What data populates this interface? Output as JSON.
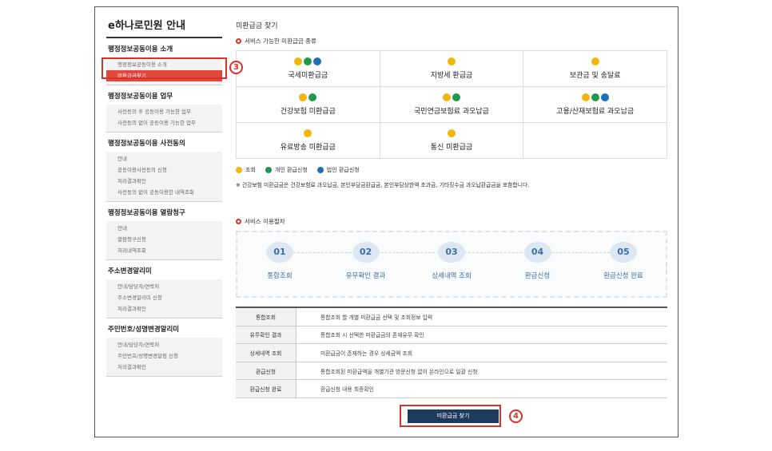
{
  "sidebar": {
    "title": "e하나로민원 안내",
    "groups": [
      {
        "title": "행정정보공동이용 소개",
        "items": [
          "행정정보공동이용 소개",
          "미환급금찾기"
        ]
      },
      {
        "title": "행정정보공동이용 업무",
        "items": [
          "사전동의 후 공동이용 가능한 업무",
          "사전동의 없이 공동이용 가능한 업무"
        ]
      },
      {
        "title": "행정정보공동이용 사전동의",
        "items": [
          "안내",
          "공동이용사전동의 신청",
          "처리결과확인",
          "사전동의 없이 공동이용한 내역조회"
        ]
      },
      {
        "title": "행정정보공동이용 열람청구",
        "items": [
          "안내",
          "열람청구신청",
          "처리내역조회"
        ]
      },
      {
        "title": "주소변경알리미",
        "items": [
          "안내/담당자/연락처",
          "주소변경알리미 신청",
          "처리결과확인"
        ]
      },
      {
        "title": "주민번호/성명변경알리미",
        "items": [
          "안내/담당자/연락처",
          "주민번호/성명변경알림 신청",
          "처리결과확인"
        ]
      }
    ]
  },
  "annotations": {
    "badge3": "3",
    "badge4": "4"
  },
  "main": {
    "page_title": "미환급금 찾기",
    "section1_title": "서비스 가능한 미환급금 종류",
    "cells": [
      {
        "label": "국세미환급금",
        "dots": [
          "#f2b70f",
          "#1f9a4a",
          "#1f6fb5"
        ]
      },
      {
        "label": "지방세 환급금",
        "dots": [
          "#f2b70f"
        ]
      },
      {
        "label": "보관금 및 송달료",
        "dots": [
          "#f2b70f"
        ]
      },
      {
        "label": "건강보험 미환급금",
        "dots": [
          "#f2b70f",
          "#1f9a4a"
        ]
      },
      {
        "label": "국민연금보험료 과오납금",
        "dots": [
          "#f2b70f",
          "#1f9a4a"
        ]
      },
      {
        "label": "고용/산재보험료 과오납금",
        "dots": [
          "#f2b70f",
          "#1f9a4a",
          "#1f6fb5"
        ]
      },
      {
        "label": "유료방송 미환급금",
        "dots": [
          "#f2b70f"
        ]
      },
      {
        "label": "통신 미환급금",
        "dots": [
          "#f2b70f"
        ]
      },
      {
        "label": "",
        "dots": []
      }
    ],
    "legend": [
      {
        "label": "조회",
        "color": "#f2b70f"
      },
      {
        "label": "개인 환급신청",
        "color": "#1f9a4a"
      },
      {
        "label": "법인 환급신청",
        "color": "#1f6fb5"
      }
    ],
    "note": "※ 건강보험 미환급금은 건강보험료 과오납금, 본인부담금환급금, 본인부담상한액 초과금, 기타징수금 과오납환급금을 포함합니다.",
    "section2_title": "서비스 이용절차",
    "steps": [
      {
        "num": "01",
        "label": "통합조회"
      },
      {
        "num": "02",
        "label": "유무확인 결과"
      },
      {
        "num": "03",
        "label": "상세내역 조회"
      },
      {
        "num": "04",
        "label": "환급신청"
      },
      {
        "num": "05",
        "label": "환급신청 완료"
      }
    ],
    "table": [
      {
        "key": "통합조회",
        "value": "통합조회 할 개별 미환급금 선택 및 조회정보 입력"
      },
      {
        "key": "유무확인 결과",
        "value": "통합조회 시 선택한 미환급금의 존재유무 확인"
      },
      {
        "key": "상세내역 조회",
        "value": "미환급금이 존재하는 경우 상세금액 조회"
      },
      {
        "key": "환급신청",
        "value": "통합조회된 미환급액을 개별기관 방문신청 없이 온라인으로 일괄 신청"
      },
      {
        "key": "환급신청 완료",
        "value": "환급신청 내용 최종확인"
      }
    ],
    "find_button": "미환급금 찾기"
  }
}
